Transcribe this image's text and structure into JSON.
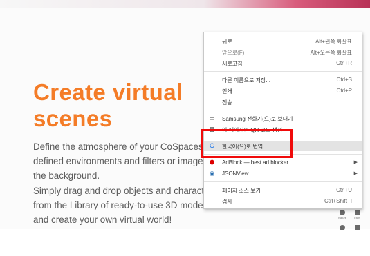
{
  "heading": "Create virtual scenes",
  "paragraph1": "Define the atmosphere of your CoSpaces pre-defined environments and filters or images for the background.",
  "paragraph2": "Simply drag and drop objects and characters from the Library of ready-to-use 3D models and create your own virtual world!",
  "menu": {
    "back": {
      "label": "뒤로",
      "shortcut": "Alt+왼쪽 화살표"
    },
    "forward": {
      "label": "앞으로(F)",
      "shortcut": "Alt+오른쪽 화살표"
    },
    "reload": {
      "label": "새로고침",
      "shortcut": "Ctrl+R"
    },
    "save_as": {
      "label": "다른 이름으로 저장...",
      "shortcut": "Ctrl+S"
    },
    "print": {
      "label": "인쇄",
      "shortcut": "Ctrl+P"
    },
    "cast": {
      "label": "전송..."
    },
    "samsung": {
      "label": "Samsung 전화기(으)로 보내기"
    },
    "qr": {
      "label": "이 페이지의 QR 코드 생성"
    },
    "translate": {
      "label": "한국어(으)로 번역"
    },
    "adblock": {
      "label": "AdBlock — best ad blocker"
    },
    "jsonview": {
      "label": "JSONView"
    },
    "view_source": {
      "label": "페이지 소스 보기",
      "shortcut": "Ctrl+U"
    },
    "inspect": {
      "label": "검사",
      "shortcut": "Ctrl+Shift+I"
    }
  },
  "side_icons": {
    "nature": "Nature",
    "trans": "Trans"
  }
}
